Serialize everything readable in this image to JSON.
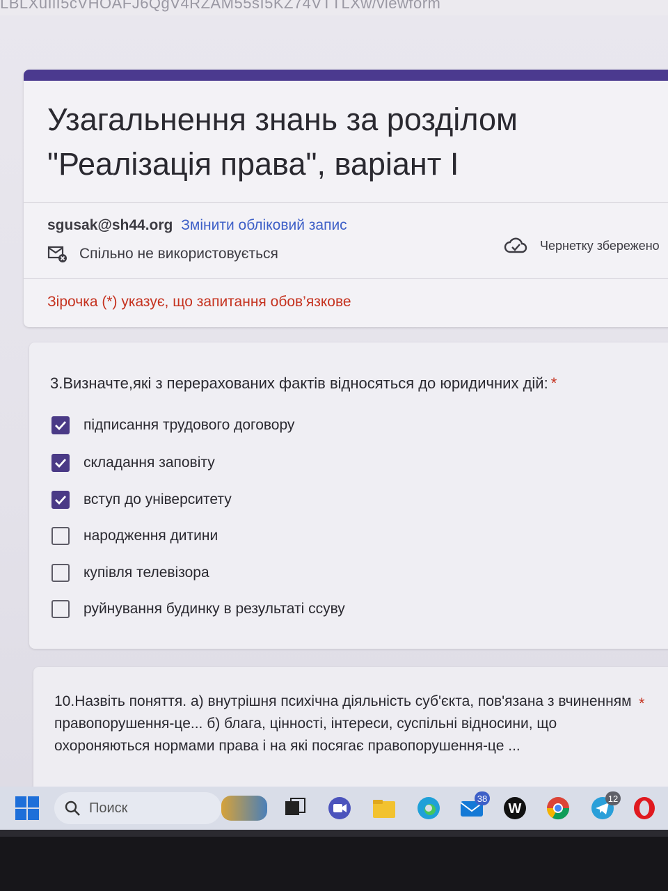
{
  "browser": {
    "url_fragment": "LBLXuIlI5cVHOAFJ6QgV4RZAM55sI5KZ74VTTLXw/viewform"
  },
  "form": {
    "title": "Узагальнення  знань за розділом\n\"Реалізація права\", варіант І",
    "accent_color": "#4b3a8f",
    "account_email": "sgusak@sh44.org",
    "switch_account_link": "Змінити обліковий запис",
    "not_shared_text": "Спільно не використовується",
    "draft_saved_text": "Чернетку збережено",
    "required_note": "Зірочка (*) указує, що запитання обов’язкове",
    "required_color": "#c5321f"
  },
  "question3": {
    "title": "3.Визначте,які з перерахованих фактів відносяться до юридичних дій:",
    "required_mark": "*",
    "options": [
      {
        "label": "підписання трудового договору",
        "checked": true
      },
      {
        "label": "складання заповіту",
        "checked": true
      },
      {
        "label": "вступ до університету",
        "checked": true
      },
      {
        "label": "народження дитини",
        "checked": false
      },
      {
        "label": "купівля телевізора",
        "checked": false
      },
      {
        "label": "руйнування будинку в результаті ссуву",
        "checked": false
      }
    ]
  },
  "question10": {
    "text": "10.Назвіть поняття.    а) внутрішня психічна діяльність суб'єкта, пов'язана з вчиненням правопорушення-це...    б) блага, цінності, інтереси, суспільні відносини,  що охороняються нормами права і  на які посягає правопорушення-це ...",
    "required_mark": "*"
  },
  "taskbar": {
    "search_placeholder": "Поиск",
    "mail_badge": "38",
    "telegram_badge": "12"
  }
}
